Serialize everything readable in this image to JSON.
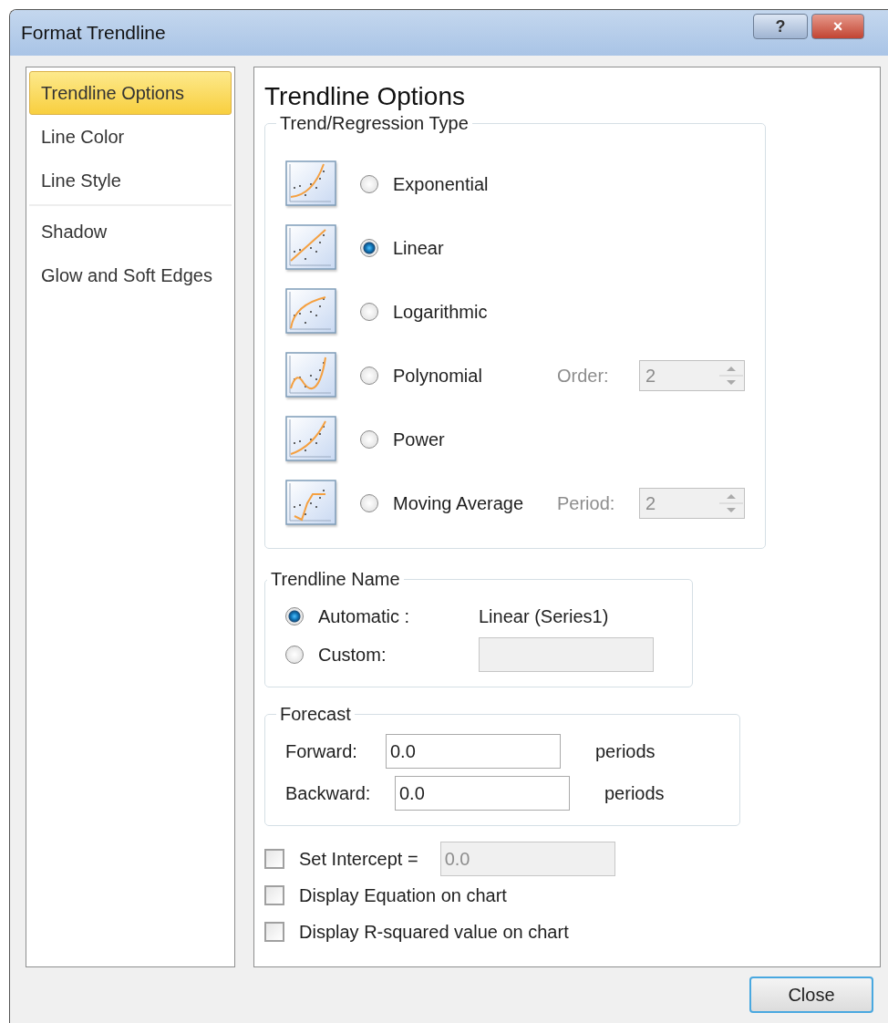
{
  "window": {
    "title": "Format Trendline",
    "help_button": "?",
    "close_button": "×"
  },
  "sidebar": {
    "groups": [
      {
        "items": [
          {
            "label": "Trendline Options",
            "selected": true
          },
          {
            "label": "Line Color",
            "selected": false
          },
          {
            "label": "Line Style",
            "selected": false
          }
        ]
      },
      {
        "items": [
          {
            "label": "Shadow",
            "selected": false
          },
          {
            "label": "Glow and Soft Edges",
            "selected": false
          }
        ]
      }
    ]
  },
  "panel": {
    "title": "Trendline Options",
    "trend_type": {
      "legend": "Trend/Regression Type",
      "options": [
        {
          "kind": "exponential",
          "label": "Exponential",
          "selected": false
        },
        {
          "kind": "linear",
          "label": "Linear",
          "selected": true
        },
        {
          "kind": "logarithmic",
          "label": "Logarithmic",
          "selected": false
        },
        {
          "kind": "polynomial",
          "label": "Polynomial",
          "selected": false,
          "param": {
            "label": "Order:",
            "value": "2",
            "disabled": true
          }
        },
        {
          "kind": "power",
          "label": "Power",
          "selected": false
        },
        {
          "kind": "moving_average",
          "label": "Moving Average",
          "selected": false,
          "param": {
            "label": "Period:",
            "value": "2",
            "disabled": true
          }
        }
      ]
    },
    "trendline_name": {
      "legend": "Trendline Name",
      "automatic": {
        "label": "Automatic :",
        "selected": true,
        "value": "Linear (Series1)"
      },
      "custom": {
        "label": "Custom:",
        "selected": false,
        "disabled": true
      }
    },
    "forecast": {
      "legend": "Forecast",
      "rows": [
        {
          "label": "Forward:",
          "value": "0.0",
          "unit": "periods"
        },
        {
          "label": "Backward:",
          "value": "0.0",
          "unit": "periods"
        }
      ]
    },
    "options": [
      {
        "label": "Set Intercept =",
        "checked": false,
        "value": "0.0",
        "disabled": true
      },
      {
        "label": "Display Equation on chart",
        "checked": false
      },
      {
        "label": "Display R-squared value on chart",
        "checked": false
      }
    ]
  },
  "footer": {
    "close": "Close"
  }
}
